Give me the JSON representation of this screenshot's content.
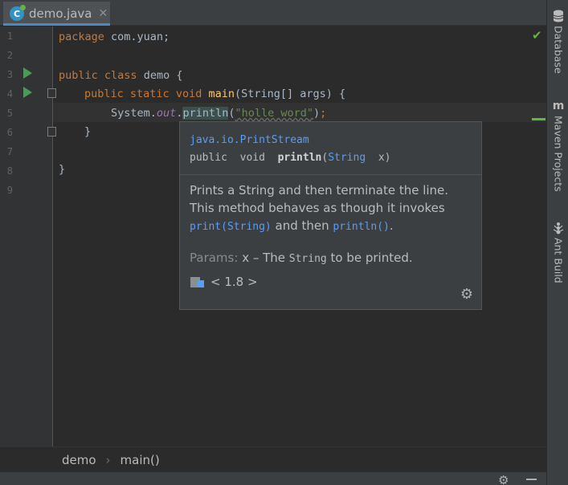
{
  "tab": {
    "icon": "java-class-icon",
    "icon_glyph": "C",
    "label": "demo.java",
    "close": "✕"
  },
  "gutter": {
    "line_numbers": [
      "1",
      "2",
      "3",
      "4",
      "5",
      "6",
      "7",
      "8",
      "9"
    ]
  },
  "code": {
    "line1": {
      "kw": "package",
      "rest": " com.yuan;"
    },
    "line3": {
      "kw1": "public",
      "kw2": "class",
      "name": " demo {"
    },
    "line4": {
      "kw1": "public",
      "kw2": "static",
      "kw3": "void",
      "fn": "main",
      "rest": "(String[] args) {"
    },
    "line5": {
      "a": "System.",
      "field": "out",
      "b": ".",
      "call": "println",
      "open": "(",
      "str": "\"holle word\"",
      "close": ")",
      "semi": ";"
    },
    "line6": "}",
    "line8": "}"
  },
  "popup": {
    "package": "java.io.PrintStream",
    "sig_mods": "public  void  ",
    "sig_name": "println",
    "sig_paren": "(",
    "sig_type": "String",
    "sig_arg": "  x)",
    "desc1": "Prints a String and then terminate the line.",
    "desc2": "This method behaves as though it invokes",
    "ref1": "print(String)",
    "and": " and then ",
    "ref2": "println()",
    "dot": ".",
    "params_label": "Params:",
    "params_x": "x",
    "params_dash": " – The ",
    "params_string": "String",
    "params_rest": " to be printed.",
    "sdk": "< 1.8 >"
  },
  "breadcrumb": {
    "item1": "demo",
    "sep": "›",
    "item2": "main()"
  },
  "right_strip": [
    {
      "icon": "database-icon",
      "label": "Database"
    },
    {
      "icon": "maven-icon",
      "glyph": "m",
      "label": "Maven Projects"
    },
    {
      "icon": "ant-icon",
      "label": "Ant Build"
    }
  ],
  "colors": {
    "accent": "#4a88c7",
    "keyword": "#cc7832",
    "string": "#6a8759",
    "link": "#589df6",
    "ok": "#62b543"
  }
}
